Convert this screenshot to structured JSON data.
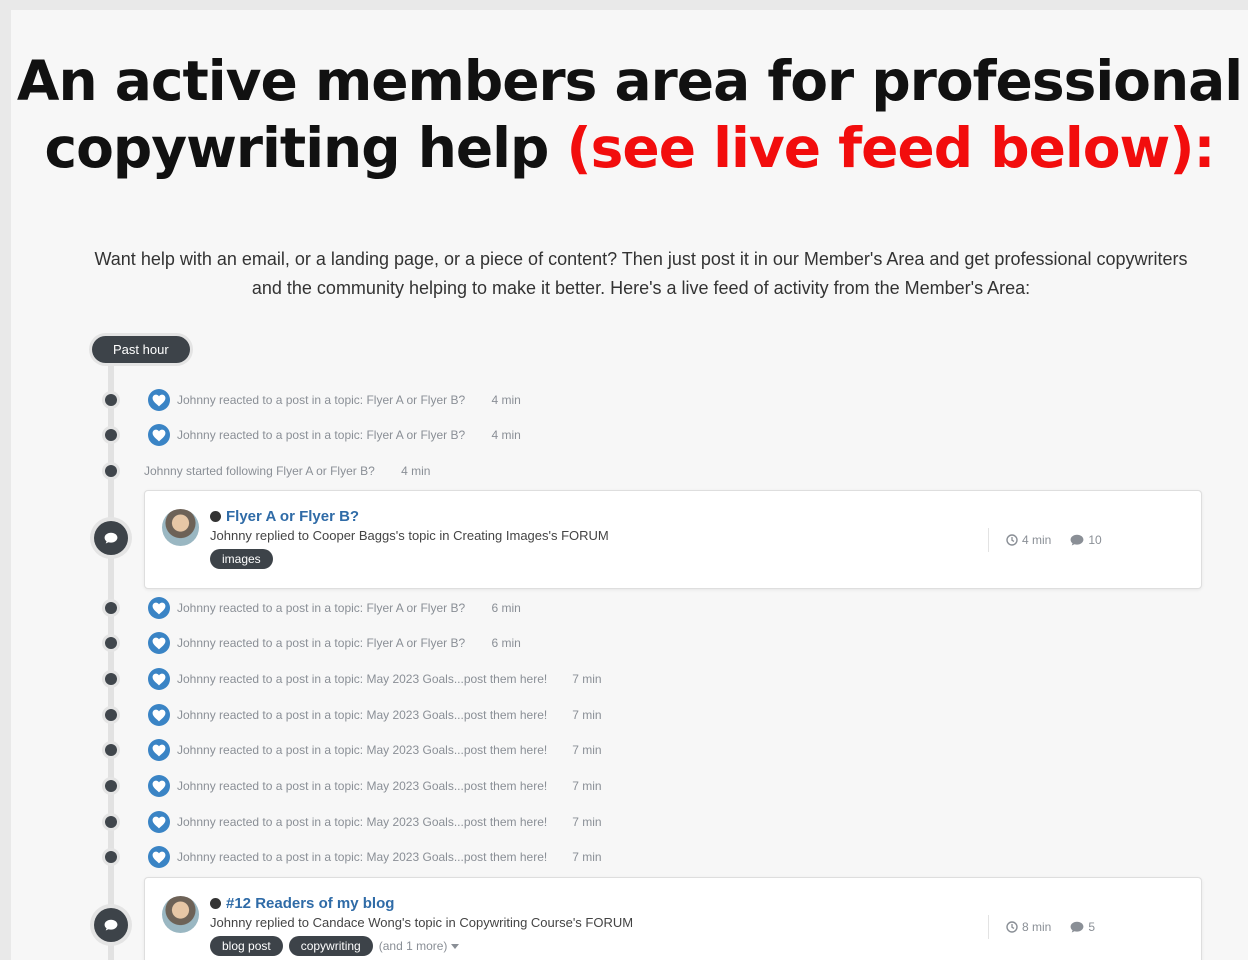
{
  "headline": {
    "line1": "An active members area for professional",
    "line2_start": "copywriting help ",
    "line2_red": "(see live feed below):"
  },
  "intro": "Want help with an email, or a landing page, or a piece of content? Then just post it in our Member's Area and get professional copywriters and the community helping to make it better. Here's a live feed of activity from the Member's Area:",
  "feed": {
    "section_label": "Past hour",
    "rows": [
      {
        "type": "reaction",
        "text": "Johnny reacted to a post in a topic: Flyer A or Flyer B?",
        "time": "4 min"
      },
      {
        "type": "reaction",
        "text": "Johnny reacted to a post in a topic: Flyer A or Flyer B?",
        "time": "4 min"
      },
      {
        "type": "follow",
        "text": "Johnny started following Flyer A or Flyer B?",
        "time": "4 min"
      },
      {
        "type": "reaction",
        "text": "Johnny reacted to a post in a topic: Flyer A or Flyer B?",
        "time": "6 min"
      },
      {
        "type": "reaction",
        "text": "Johnny reacted to a post in a topic: Flyer A or Flyer B?",
        "time": "6 min"
      },
      {
        "type": "reaction",
        "text": "Johnny reacted to a post in a topic: May 2023 Goals...post them here!",
        "time": "7 min"
      },
      {
        "type": "reaction",
        "text": "Johnny reacted to a post in a topic: May 2023 Goals...post them here!",
        "time": "7 min"
      },
      {
        "type": "reaction",
        "text": "Johnny reacted to a post in a topic: May 2023 Goals...post them here!",
        "time": "7 min"
      },
      {
        "type": "reaction",
        "text": "Johnny reacted to a post in a topic: May 2023 Goals...post them here!",
        "time": "7 min"
      },
      {
        "type": "reaction",
        "text": "Johnny reacted to a post in a topic: May 2023 Goals...post them here!",
        "time": "7 min"
      },
      {
        "type": "reaction",
        "text": "Johnny reacted to a post in a topic: May 2023 Goals...post them here!",
        "time": "7 min"
      }
    ],
    "cards": [
      {
        "title": "Flyer A or Flyer B?",
        "subtitle": "Johnny replied to Cooper Baggs's topic in Creating Images's FORUM",
        "tags": [
          "images"
        ],
        "more": "",
        "time": "4 min",
        "comments": "10"
      },
      {
        "title": "#12 Readers of my blog",
        "subtitle": "Johnny replied to Candace Wong's topic in Copywriting Course's FORUM",
        "tags": [
          "blog post",
          "copywriting"
        ],
        "more": "(and 1 more)",
        "time": "8 min",
        "comments": "5"
      }
    ]
  }
}
